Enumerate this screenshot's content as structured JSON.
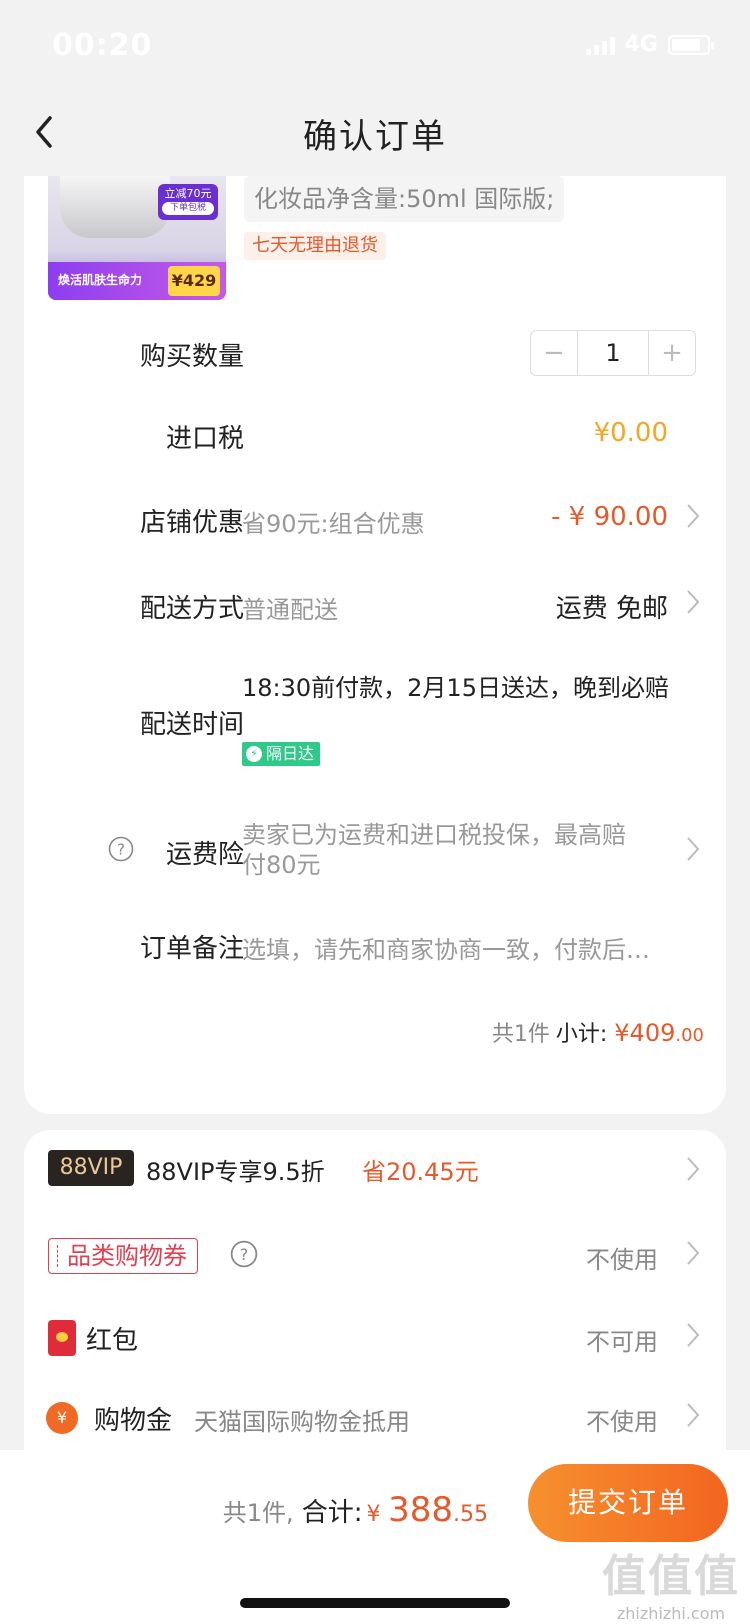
{
  "status": {
    "time": "00:20",
    "network": "4G"
  },
  "nav": {
    "title": "确认订单"
  },
  "product": {
    "image": {
      "promo_tag": "立减70元",
      "promo_tag_sub": "下单包税",
      "promo_text": "焕活肌肤生命力",
      "promo_price": "¥429"
    },
    "spec": "化妆品净含量:50ml 国际版;",
    "return_policy": "七天无理由退货"
  },
  "order": {
    "quantity_label": "购买数量",
    "quantity": "1",
    "minus": "−",
    "plus": "+",
    "tax_label": "进口税",
    "tax_value": "¥0.00",
    "shop_discount_label": "店铺优惠",
    "shop_discount_desc": "省90元:组合优惠",
    "shop_discount_value": "- ¥ 90.00",
    "delivery_label": "配送方式",
    "delivery_desc": "普通配送",
    "delivery_right": "运费 免邮",
    "delivery_time_label": "配送时间",
    "delivery_time_desc": "18:30前付款，2月15日送达，晚到必赔",
    "next_day_badge": "隔日达",
    "insurance_label": "运费险",
    "insurance_desc": "卖家已为运费和进口税投保，最高赔付80元",
    "remark_label": "订单备注",
    "remark_placeholder": "选填，请先和商家协商一致，付款后…",
    "subtotal_count": "共1件",
    "subtotal_label": "小计:",
    "subtotal_yen": "¥",
    "subtotal_amount": "409",
    "subtotal_cents": ".00"
  },
  "benefits": {
    "vip_badge": "88VIP",
    "vip_text": "88VIP专享9.5折",
    "vip_save": "省20.45元",
    "coupon_label": "品类购物券",
    "coupon_value": "不使用",
    "redpacket_label": "红包",
    "redpacket_value": "不可用",
    "gold_label": "购物金",
    "gold_desc": "天猫国际购物金抵用",
    "gold_value": "不使用"
  },
  "footer": {
    "count": "共1件,",
    "total_label": "合计:",
    "yen": "¥",
    "amount": "388",
    "cents": ".55",
    "submit": "提交订单"
  },
  "watermark": {
    "logo": "值值值",
    "url": "zhizhizhi.com"
  },
  "colors": {
    "accent": "#e55a2b",
    "tax": "#f5a623",
    "badge_green": "#2fc98a",
    "submit_from": "#f7902f",
    "submit_to": "#f26520"
  }
}
